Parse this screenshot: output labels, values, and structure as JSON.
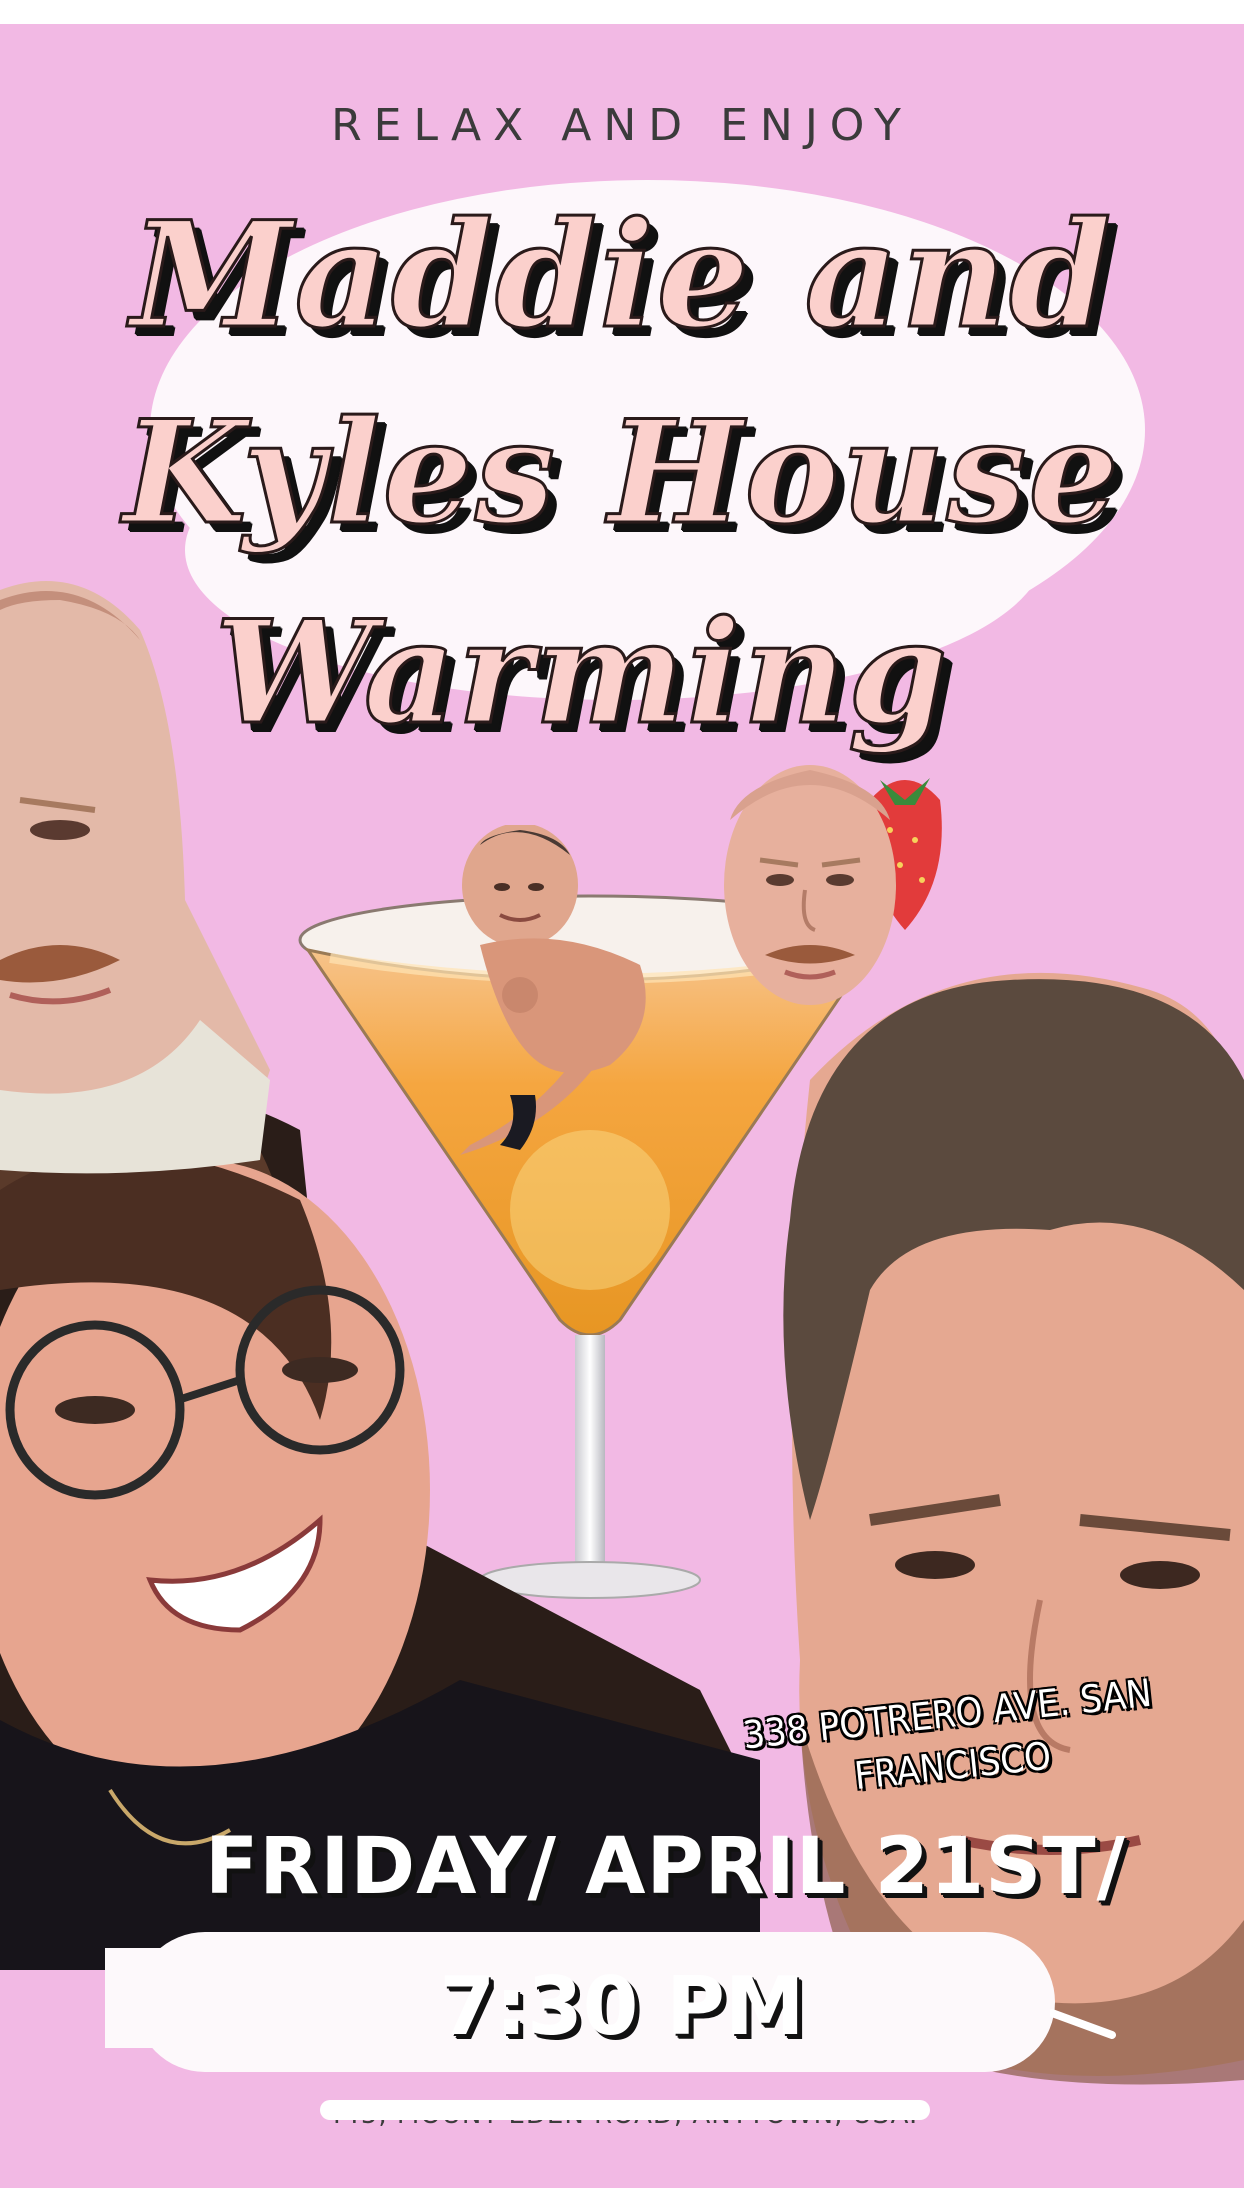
{
  "flyer": {
    "tagline": "RELAX AND ENJOY",
    "title_lines": [
      "Maddie and",
      "Kyles House",
      "Warming"
    ],
    "address": "338 POTRERO AVE. SAN FRANCISCO",
    "date": "FRIDAY/ APRIL 21ST/",
    "time": "7:30 PM",
    "footer_address": "445, MOUNT EDEN ROAD, ANYTOWN, USA."
  },
  "colors": {
    "background": "#f2b9e4",
    "title_fill": "#fbd0cc",
    "cloud": "#fdf7fb",
    "drink": "#f4a53a"
  },
  "images": {
    "left_head": "photo of man's head (top left)",
    "woman": "photo of smiling woman with round glasses",
    "man_right": "photo of man with short brown hair",
    "small_head": "photo of man's head on strawberry",
    "small_man": "cutout of man in cocktail glass"
  }
}
